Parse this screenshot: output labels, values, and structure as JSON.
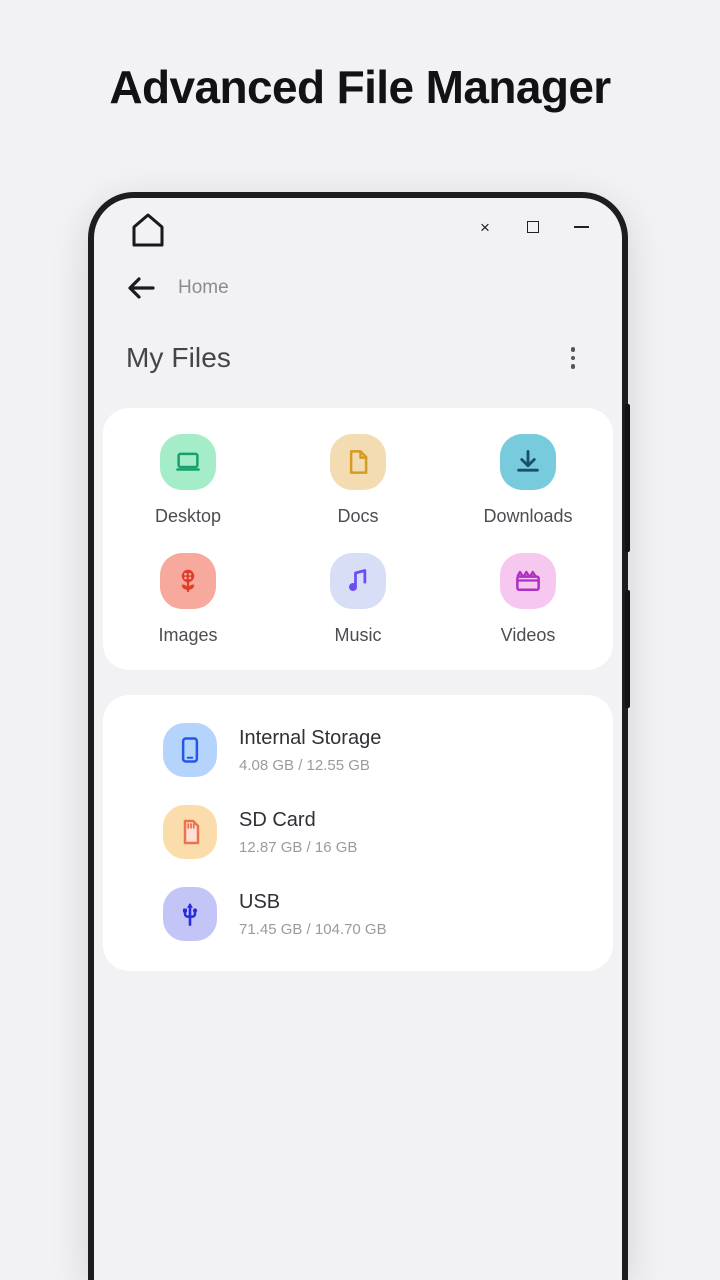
{
  "page": {
    "title": "Advanced File Manager",
    "background_color": "#f2f1f4"
  },
  "window_chrome": {
    "home_icon": "home-icon",
    "controls": [
      {
        "name": "close",
        "glyph": "×"
      },
      {
        "name": "maximize",
        "glyph": "□"
      },
      {
        "name": "minimize",
        "glyph": "—"
      }
    ]
  },
  "breadcrumb": {
    "back_icon": "back-arrow-icon",
    "label": "Home"
  },
  "app_header": {
    "title": "My Files",
    "overflow_icon": "more-vertical-icon"
  },
  "shortcuts": [
    {
      "label": "Desktop",
      "icon": "laptop-icon",
      "bg": "#a5edc9",
      "fg": "#16a06c"
    },
    {
      "label": "Docs",
      "icon": "document-icon",
      "bg": "#f3dcb2",
      "fg": "#d79a23"
    },
    {
      "label": "Downloads",
      "icon": "download-icon",
      "bg": "#77cbdd",
      "fg": "#19506b"
    },
    {
      "label": "Images",
      "icon": "flower-icon",
      "bg": "#f6a99c",
      "fg": "#e23b28"
    },
    {
      "label": "Music",
      "icon": "music-note-icon",
      "bg": "#d7def5",
      "fg": "#6c4ef0"
    },
    {
      "label": "Videos",
      "icon": "clapperboard-icon",
      "bg": "#f7c8ef",
      "fg": "#b02fc4"
    }
  ],
  "storage": [
    {
      "name": "Internal Storage",
      "meta": "4.08 GB / 12.55 GB",
      "icon": "phone-icon",
      "bg": "#b4d4fb",
      "fg": "#2456e8"
    },
    {
      "name": "SD Card",
      "meta": "12.87 GB / 16 GB",
      "icon": "sd-card-icon",
      "bg": "#fbddab",
      "fg": "#f0724a"
    },
    {
      "name": "USB",
      "meta": "71.45 GB / 104.70 GB",
      "icon": "usb-icon",
      "bg": "#c3c5f7",
      "fg": "#2a2ae0"
    }
  ]
}
